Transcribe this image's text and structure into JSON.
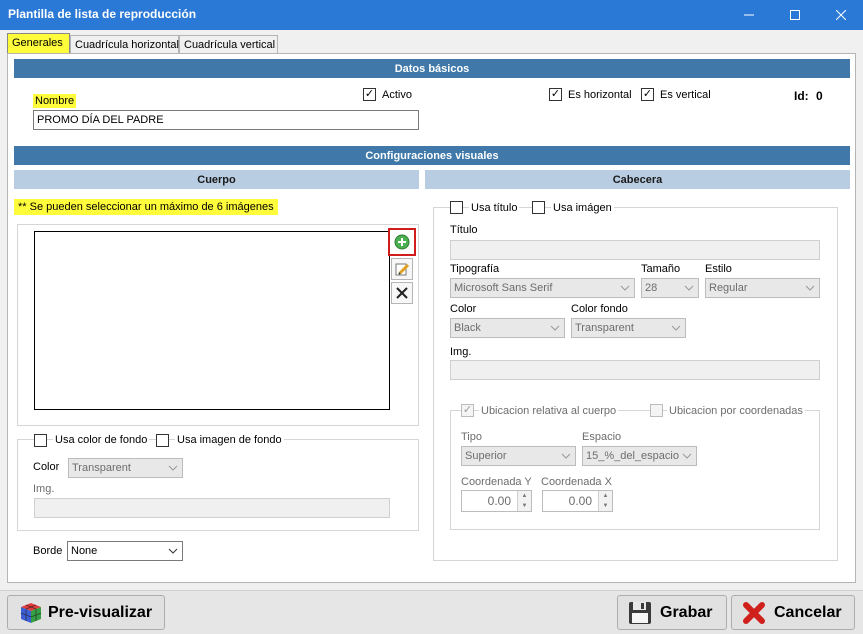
{
  "window": {
    "title": "Plantilla de lista de reproducción"
  },
  "tabs": [
    {
      "label": "Generales"
    },
    {
      "label": "Cuadrícula horizontal"
    },
    {
      "label": "Cuadrícula vertical"
    }
  ],
  "basic": {
    "header": "Datos básicos",
    "nombre_label": "Nombre",
    "nombre_value": "PROMO DÍA DEL PADRE",
    "activo_label": "Activo",
    "es_horizontal_label": "Es horizontal",
    "es_vertical_label": "Es vertical",
    "id_label": "Id:",
    "id_value": "0"
  },
  "visual": {
    "header": "Configuraciones visuales",
    "cuerpo": {
      "header": "Cuerpo",
      "note": "** Se pueden seleccionar un máximo de 6 imágenes",
      "usa_color_fondo_label": "Usa color de fondo",
      "usa_imagen_fondo_label": "Usa imagen de fondo",
      "color_label": "Color",
      "color_value": "Transparent",
      "img_label": "Img.",
      "borde_label": "Borde",
      "borde_value": "None"
    },
    "cabecera": {
      "header": "Cabecera",
      "usa_titulo_label": "Usa título",
      "usa_imagen_label": "Usa imágen",
      "titulo_label": "Título",
      "tipografia_label": "Tipografía",
      "tipografia_value": "Microsoft Sans Serif",
      "tamano_label": "Tamaño",
      "tamano_value": "28",
      "estilo_label": "Estilo",
      "estilo_value": "Regular",
      "color_label": "Color",
      "color_value": "Black",
      "color_fondo_label": "Color fondo",
      "color_fondo_value": "Transparent",
      "img_label": "Img.",
      "ubicacion_relativa_label": "Ubicacion relativa al cuerpo",
      "ubicacion_coordenadas_label": "Ubicacion por coordenadas",
      "tipo_label": "Tipo",
      "tipo_value": "Superior",
      "espacio_label": "Espacio",
      "espacio_value": "15_%_del_espacio",
      "coord_y_label": "Coordenada Y",
      "coord_y_value": "0.00",
      "coord_x_label": "Coordenada X",
      "coord_x_value": "0.00"
    }
  },
  "footer": {
    "preview_label": "Pre-visualizar",
    "save_label": "Grabar",
    "cancel_label": "Cancelar"
  },
  "colors": {
    "titlebar": "#2b79d7",
    "section_dark": "#3f78a9",
    "section_light": "#b9cde2",
    "highlight": "#fffd3b"
  }
}
